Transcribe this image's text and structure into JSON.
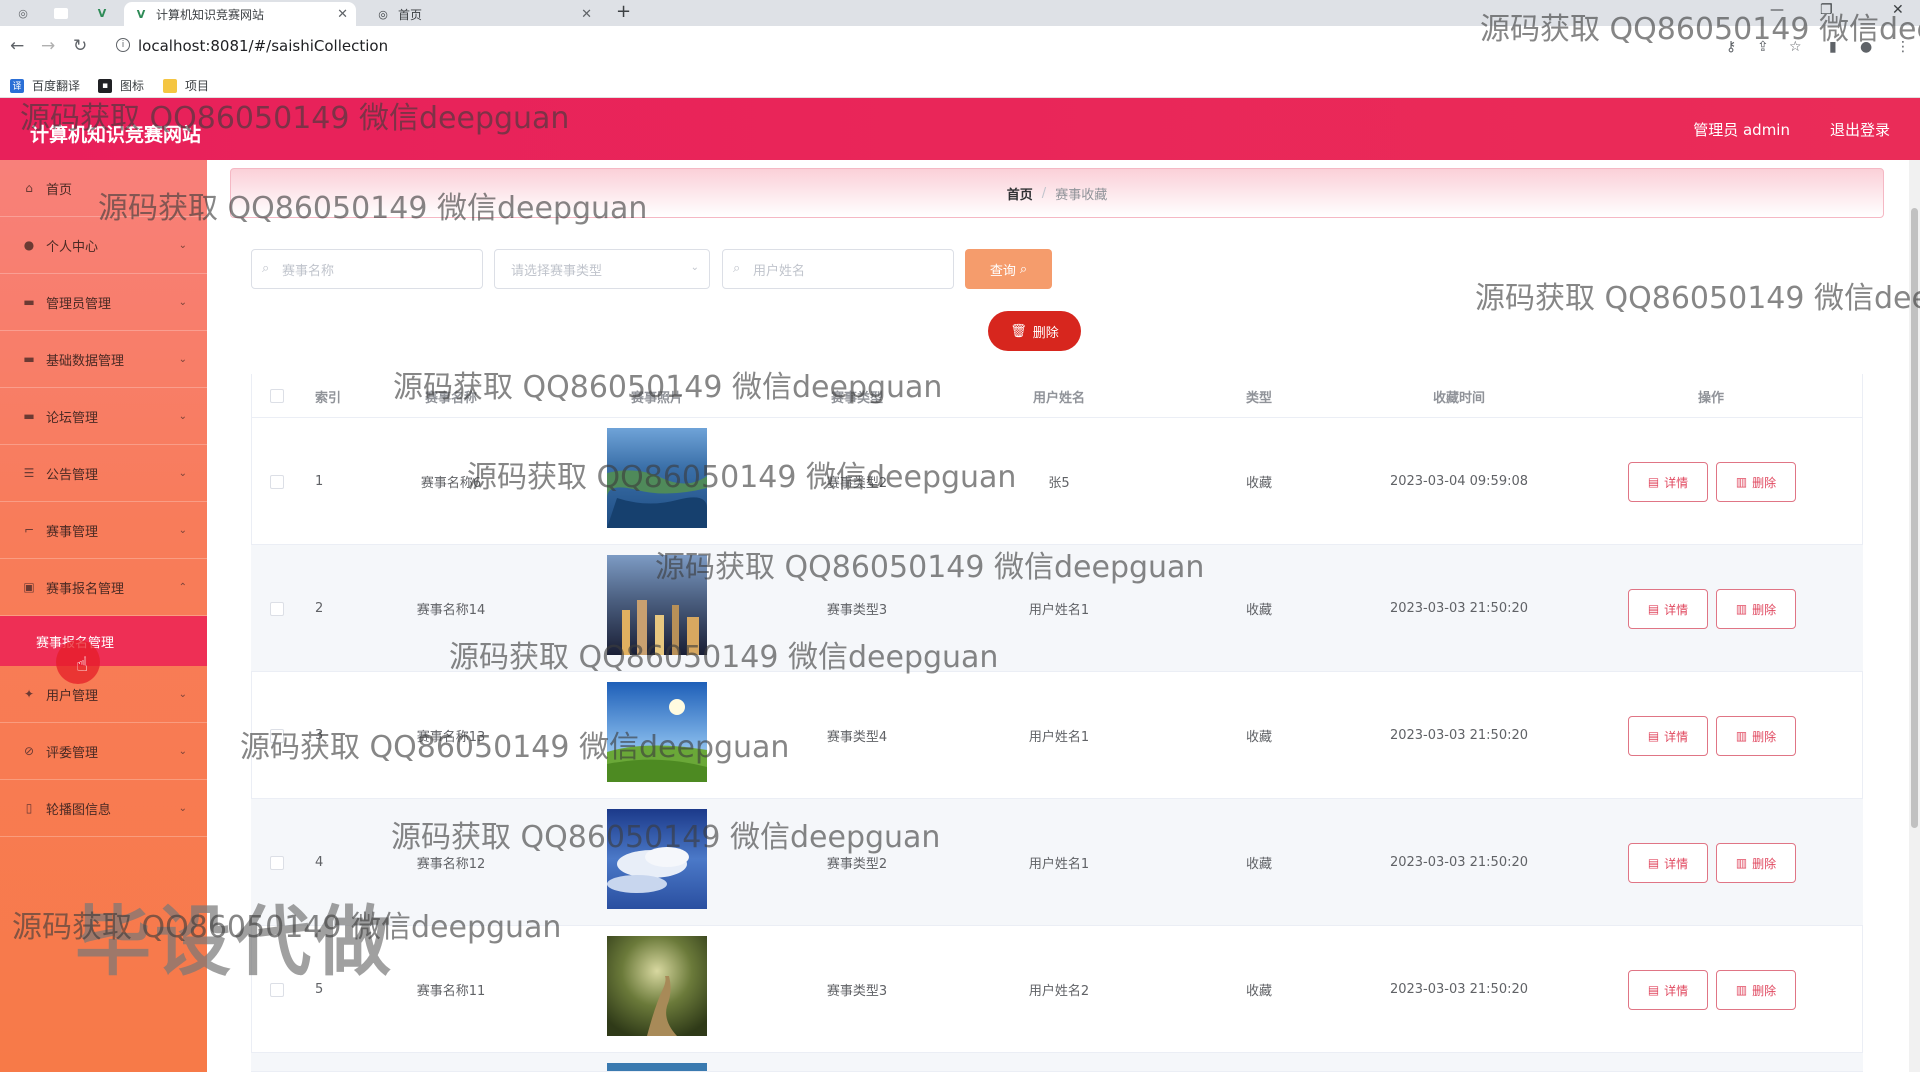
{
  "browser": {
    "tabs": [
      {
        "title": "计算机知识竞赛网站",
        "active": true
      },
      {
        "title": "首页",
        "active": false
      }
    ],
    "url": "localhost:8081/#/saishiCollection",
    "bookmarks": [
      "百度翻译",
      "图标",
      "项目"
    ]
  },
  "header": {
    "site_title": "计算机知识竞赛网站",
    "admin_label": "管理员 admin",
    "logout_label": "退出登录",
    "color": "#e91e55"
  },
  "sidebar": {
    "items": [
      {
        "label": "首页",
        "icon": "home-icon"
      },
      {
        "label": "个人中心",
        "icon": "user-icon"
      },
      {
        "label": "管理员管理",
        "icon": "monitor-icon"
      },
      {
        "label": "基础数据管理",
        "icon": "monitor-icon"
      },
      {
        "label": "论坛管理",
        "icon": "monitor-icon"
      },
      {
        "label": "公告管理",
        "icon": "list-icon"
      },
      {
        "label": "赛事管理",
        "icon": "crop-icon"
      },
      {
        "label": "赛事报名管理",
        "icon": "lock-icon"
      },
      {
        "label": "用户管理",
        "icon": "bird-icon"
      },
      {
        "label": "评委管理",
        "icon": "check-icon"
      },
      {
        "label": "轮播图信息",
        "icon": "phone-icon"
      }
    ],
    "active_sub": "赛事报名管理"
  },
  "breadcrumb": {
    "home": "首页",
    "separator": "/",
    "current": "赛事收藏"
  },
  "search": {
    "name_placeholder": "赛事名称",
    "type_placeholder": "请选择赛事类型",
    "user_placeholder": "用户姓名",
    "query_label": "查询",
    "delete_label": "删除"
  },
  "table": {
    "columns": [
      "索引",
      "赛事名称",
      "赛事照片",
      "赛事类型",
      "用户姓名",
      "类型",
      "收藏时间",
      "操作"
    ],
    "rows": [
      {
        "index": "1",
        "name": "赛事名称6",
        "type": "赛事类型2",
        "user": "张5",
        "kind": "收藏",
        "time": "2023-03-04 09:59:08"
      },
      {
        "index": "2",
        "name": "赛事名称14",
        "type": "赛事类型3",
        "user": "用户姓名1",
        "kind": "收藏",
        "time": "2023-03-03 21:50:20"
      },
      {
        "index": "3",
        "name": "赛事名称13",
        "type": "赛事类型4",
        "user": "用户姓名1",
        "kind": "收藏",
        "time": "2023-03-03 21:50:20"
      },
      {
        "index": "4",
        "name": "赛事名称12",
        "type": "赛事类型2",
        "user": "用户姓名1",
        "kind": "收藏",
        "time": "2023-03-03 21:50:20"
      },
      {
        "index": "5",
        "name": "赛事名称11",
        "type": "赛事类型3",
        "user": "用户姓名2",
        "kind": "收藏",
        "time": "2023-03-03 21:50:20"
      }
    ],
    "detail_label": "详情",
    "delete_label": "删除"
  },
  "watermarks": {
    "text": "源码获取 QQ86050149 微信deepguan",
    "text_cut": "源码获取 QQ86050149 微信dee",
    "big": "毕设代做"
  }
}
